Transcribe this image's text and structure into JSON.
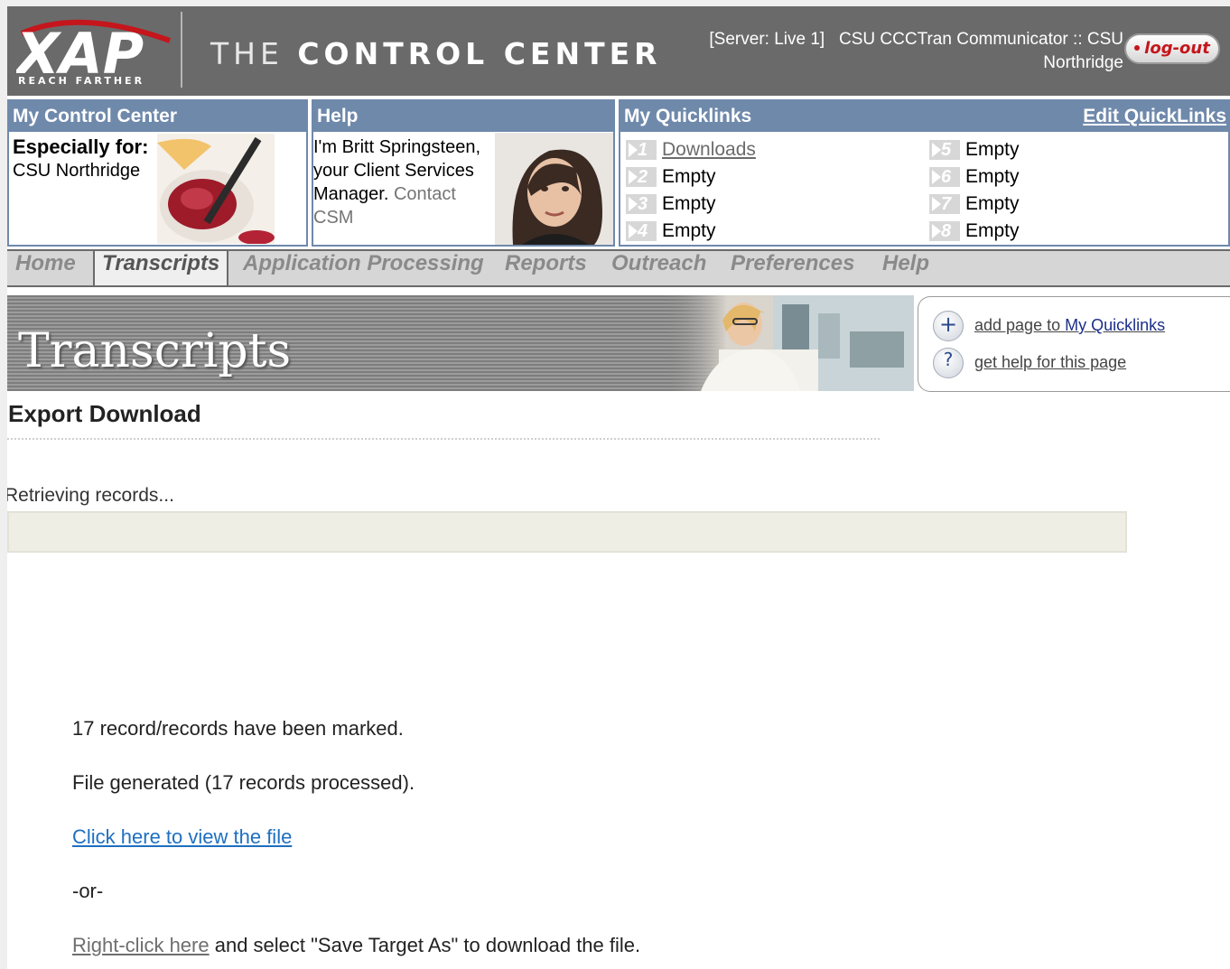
{
  "header": {
    "logo_text": "XAP",
    "tagline": "REACH FARTHER",
    "title_light": "THE ",
    "title_bold": "CONTROL CENTER",
    "server_info_line1": "[Server: Live 1]   CSU CCCTran Communicator :: CSU",
    "server_info_line2": "Northridge",
    "logout_label": "log-out"
  },
  "panels": {
    "my_control_center": {
      "title": "My Control Center",
      "especially_label": "Especially for:",
      "org_name": "CSU Northridge"
    },
    "help": {
      "title": "Help",
      "text": "I'm Britt Springsteen, your Client Services Manager. ",
      "contact_link": "Contact CSM"
    },
    "quicklinks": {
      "title": "My Quicklinks",
      "edit_label": "Edit QuickLinks",
      "items": [
        {
          "num": "1",
          "label": "Downloads",
          "link": true
        },
        {
          "num": "2",
          "label": "Empty",
          "link": false
        },
        {
          "num": "3",
          "label": "Empty",
          "link": false
        },
        {
          "num": "4",
          "label": "Empty",
          "link": false
        },
        {
          "num": "5",
          "label": "Empty",
          "link": false
        },
        {
          "num": "6",
          "label": "Empty",
          "link": false
        },
        {
          "num": "7",
          "label": "Empty",
          "link": false
        },
        {
          "num": "8",
          "label": "Empty",
          "link": false
        }
      ]
    }
  },
  "nav": {
    "items": [
      "Home",
      "Transcripts",
      "Application Processing",
      "Reports",
      "Outreach",
      "Preferences",
      "Help"
    ],
    "active": "Transcripts"
  },
  "banner": {
    "title": "Transcripts"
  },
  "tools": {
    "add_prefix": "add page to ",
    "add_target": "My Quicklinks",
    "help_label": "get help for this page",
    "add_icon": "plus-icon",
    "help_icon": "question-icon"
  },
  "content": {
    "heading": "Export Download",
    "retrieving": "Retrieving records...",
    "marked_msg": "17 record/records have been marked.",
    "generated_msg": "File generated (17 records processed).",
    "view_file_link": "Click here to view the file",
    "or_text": "-or-",
    "right_click_link": "Right-click here",
    "right_click_suffix": " and select \"Save Target As\" to download the file."
  },
  "colors": {
    "header_bg": "#6a6a6a",
    "panel_accent": "#6f89ab",
    "logout_text": "#c4161c",
    "link_blue": "#1e6fc1"
  }
}
